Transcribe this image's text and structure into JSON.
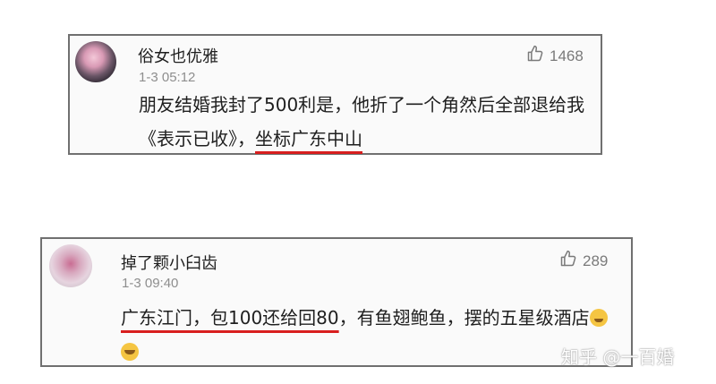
{
  "comments": [
    {
      "username": "俗女也优雅",
      "timestamp": "1-3 05:12",
      "likes": "1468",
      "text_before": "朋友结婚我封了500利是，他折了一个角然后全部退给我《表示已收》，",
      "text_highlight": "坐标广东中山",
      "text_after": ""
    },
    {
      "username": "掉了颗小臼齿",
      "timestamp": "1-3 09:40",
      "likes": "289",
      "text_before": "",
      "text_highlight": "广东江门，包100还给回80",
      "text_after": "，有鱼翅鲍鱼，摆的五星级酒店"
    }
  ],
  "watermark": "知乎 @一百婚",
  "colors": {
    "highlight_underline": "#d81e1e",
    "card_border": "#707070",
    "timestamp": "#8e8e8e"
  },
  "icons": [
    "thumbs-up-icon",
    "laughing-tears-emoji",
    "tears-of-joy-emoji"
  ]
}
